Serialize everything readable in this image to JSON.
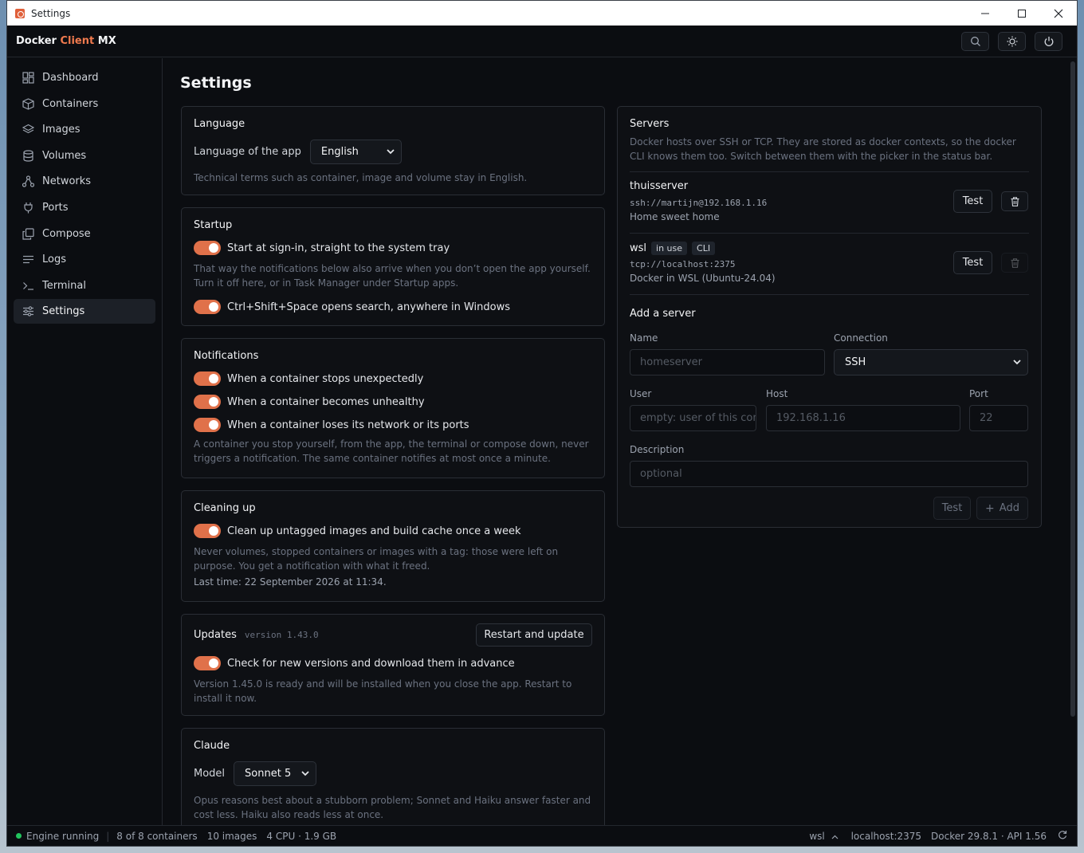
{
  "window": {
    "title": "Settings"
  },
  "brand": {
    "part1": "Docker",
    "part2": "Client",
    "part3": "MX"
  },
  "sidebar": {
    "items": [
      {
        "label": "Dashboard",
        "icon": "dashboard-icon"
      },
      {
        "label": "Containers",
        "icon": "box-icon"
      },
      {
        "label": "Images",
        "icon": "layers-icon"
      },
      {
        "label": "Volumes",
        "icon": "database-icon"
      },
      {
        "label": "Networks",
        "icon": "network-icon"
      },
      {
        "label": "Ports",
        "icon": "plug-icon"
      },
      {
        "label": "Compose",
        "icon": "copy-icon"
      },
      {
        "label": "Logs",
        "icon": "lines-icon"
      },
      {
        "label": "Terminal",
        "icon": "terminal-icon"
      },
      {
        "label": "Settings",
        "icon": "sliders-icon"
      }
    ],
    "active": "Settings"
  },
  "page": {
    "title": "Settings"
  },
  "language": {
    "heading": "Language",
    "label": "Language of the app",
    "value": "English",
    "hint": "Technical terms such as container, image and volume stay in English."
  },
  "startup": {
    "heading": "Startup",
    "toggle1": "Start at sign-in, straight to the system tray",
    "hint": "That way the notifications below also arrive when you don’t open the app yourself. Turn it off here, or in Task Manager under Startup apps.",
    "toggle2": "Ctrl+Shift+Space opens search, anywhere in Windows"
  },
  "notifications": {
    "heading": "Notifications",
    "toggle1": "When a container stops unexpectedly",
    "toggle2": "When a container becomes unhealthy",
    "toggle3": "When a container loses its network or its ports",
    "hint": "A container you stop yourself, from the app, the terminal or compose down, never triggers a notification. The same container notifies at most once a minute."
  },
  "cleanup": {
    "heading": "Cleaning up",
    "toggle1": "Clean up untagged images and build cache once a week",
    "hint": "Never volumes, stopped containers or images with a tag: those were left on purpose. You get a notification with what it freed.",
    "last": "Last time: 22 September 2026 at 11:34."
  },
  "updates": {
    "heading": "Updates",
    "version": "version 1.43.0",
    "button": "Restart and update",
    "toggle1": "Check for new versions and download them in advance",
    "hint": "Version 1.45.0 is ready and will be installed when you close the app. Restart to install it now."
  },
  "claude": {
    "heading": "Claude",
    "model_label": "Model",
    "model_value": "Sonnet 5",
    "hint": "Opus reasons best about a stubborn problem; Sonnet and Haiku answer faster and cost less. Haiku also reads less at once."
  },
  "servers": {
    "heading": "Servers",
    "hint": "Docker hosts over SSH or TCP. They are stored as docker contexts, so the docker CLI knows them too. Switch between them with the picker in the status bar.",
    "list": [
      {
        "name": "thuisserver",
        "url": "ssh://martijn@192.168.1.16",
        "desc": "Home sweet home",
        "test": "Test"
      },
      {
        "name": "wsl",
        "tag1": "in use",
        "tag2": "CLI",
        "url": "tcp://localhost:2375",
        "desc": "Docker in WSL (Ubuntu-24.04)",
        "test": "Test"
      }
    ],
    "add": {
      "heading": "Add a server",
      "name_label": "Name",
      "name_placeholder": "homeserver",
      "connection_label": "Connection",
      "connection_value": "SSH",
      "user_label": "User",
      "user_placeholder": "empty: user of this computer",
      "host_label": "Host",
      "host_placeholder": "192.168.1.16",
      "port_label": "Port",
      "port_placeholder": "22",
      "desc_label": "Description",
      "desc_placeholder": "optional",
      "test": "Test",
      "add": "Add"
    }
  },
  "status": {
    "engine": "Engine running",
    "containers": "8 of 8 containers",
    "images": "10 images",
    "resources": "4 CPU · 1.9 GB",
    "context": "wsl",
    "host": "localhost:2375",
    "docker": "Docker 29.8.1 · API 1.56"
  },
  "colors": {
    "accent": "#e0714a",
    "running": "#22c55e"
  }
}
